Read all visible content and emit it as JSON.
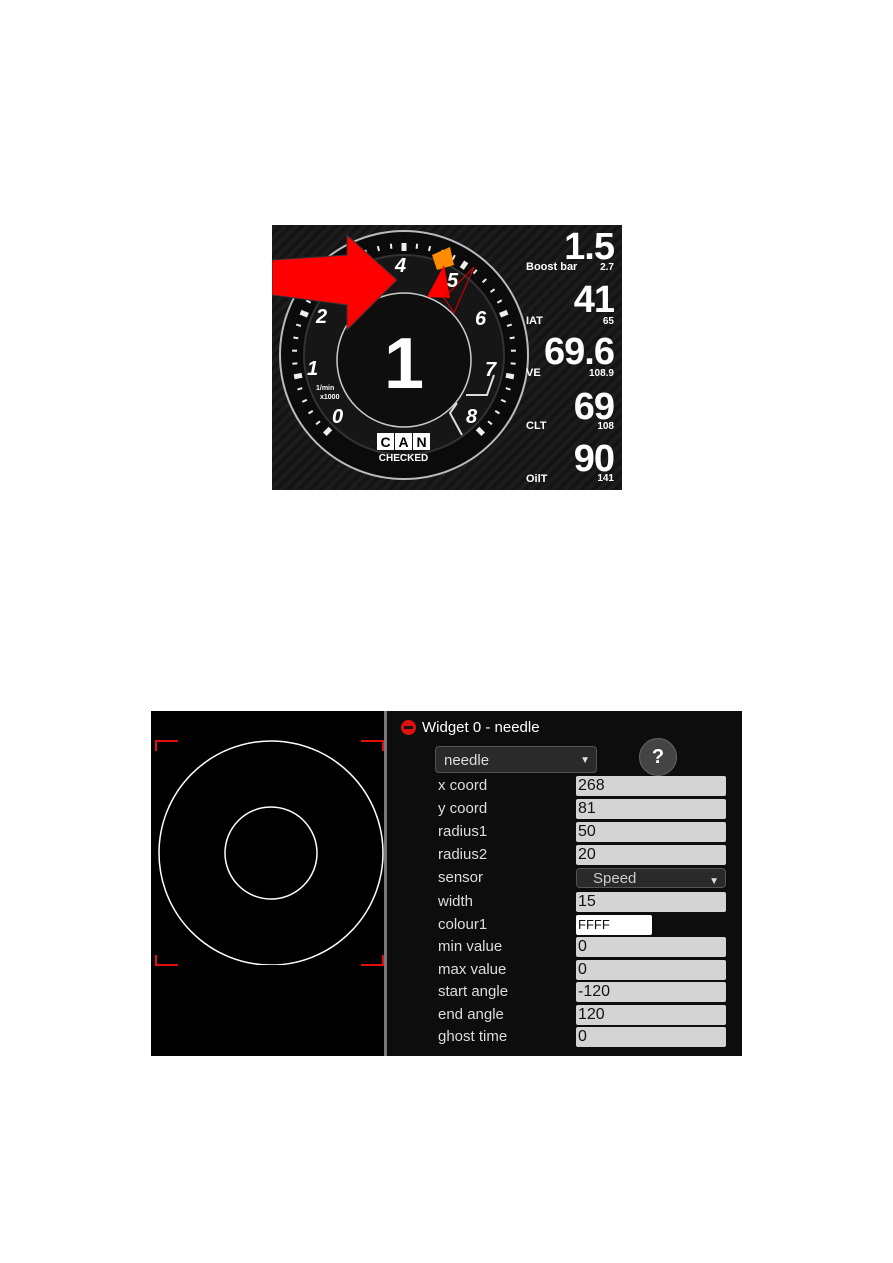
{
  "dashboard": {
    "gear": "1",
    "tach_labels": [
      "0",
      "1",
      "2",
      "4",
      "5",
      "6",
      "7",
      "8"
    ],
    "tach_unit": [
      "1/min",
      "x1000"
    ],
    "logo": {
      "top": [
        "C",
        "A",
        "N"
      ],
      "bottom": "CHECKED"
    },
    "readouts": [
      {
        "value": "1.5",
        "label": "Boost bar",
        "sub": "2.7"
      },
      {
        "value": "41",
        "label": "IAT",
        "sub": "65"
      },
      {
        "value": "69.6",
        "label": "VE",
        "sub": "108.9"
      },
      {
        "value": "69",
        "label": "CLT",
        "sub": "108"
      },
      {
        "value": "90",
        "label": "OilT",
        "sub": "141"
      }
    ],
    "colors": {
      "arrow": "#ff0000",
      "shift": "#ff8800"
    }
  },
  "editor": {
    "widget_title": "Widget 0 - needle",
    "type_select": "needle",
    "help_label": "?",
    "fields": [
      {
        "label": "x coord",
        "value": "268"
      },
      {
        "label": "y coord",
        "value": "81"
      },
      {
        "label": "radius1",
        "value": "50"
      },
      {
        "label": "radius2",
        "value": "20"
      },
      {
        "label": "sensor",
        "value": "Speed",
        "kind": "select"
      },
      {
        "label": "width",
        "value": "15"
      },
      {
        "label": "colour1",
        "value": "FFFF",
        "kind": "colour"
      },
      {
        "label": "min value",
        "value": "0"
      },
      {
        "label": "max value",
        "value": "0"
      },
      {
        "label": "start angle",
        "value": "-120"
      },
      {
        "label": "end angle",
        "value": "120"
      },
      {
        "label": "ghost time",
        "value": "0"
      }
    ]
  }
}
